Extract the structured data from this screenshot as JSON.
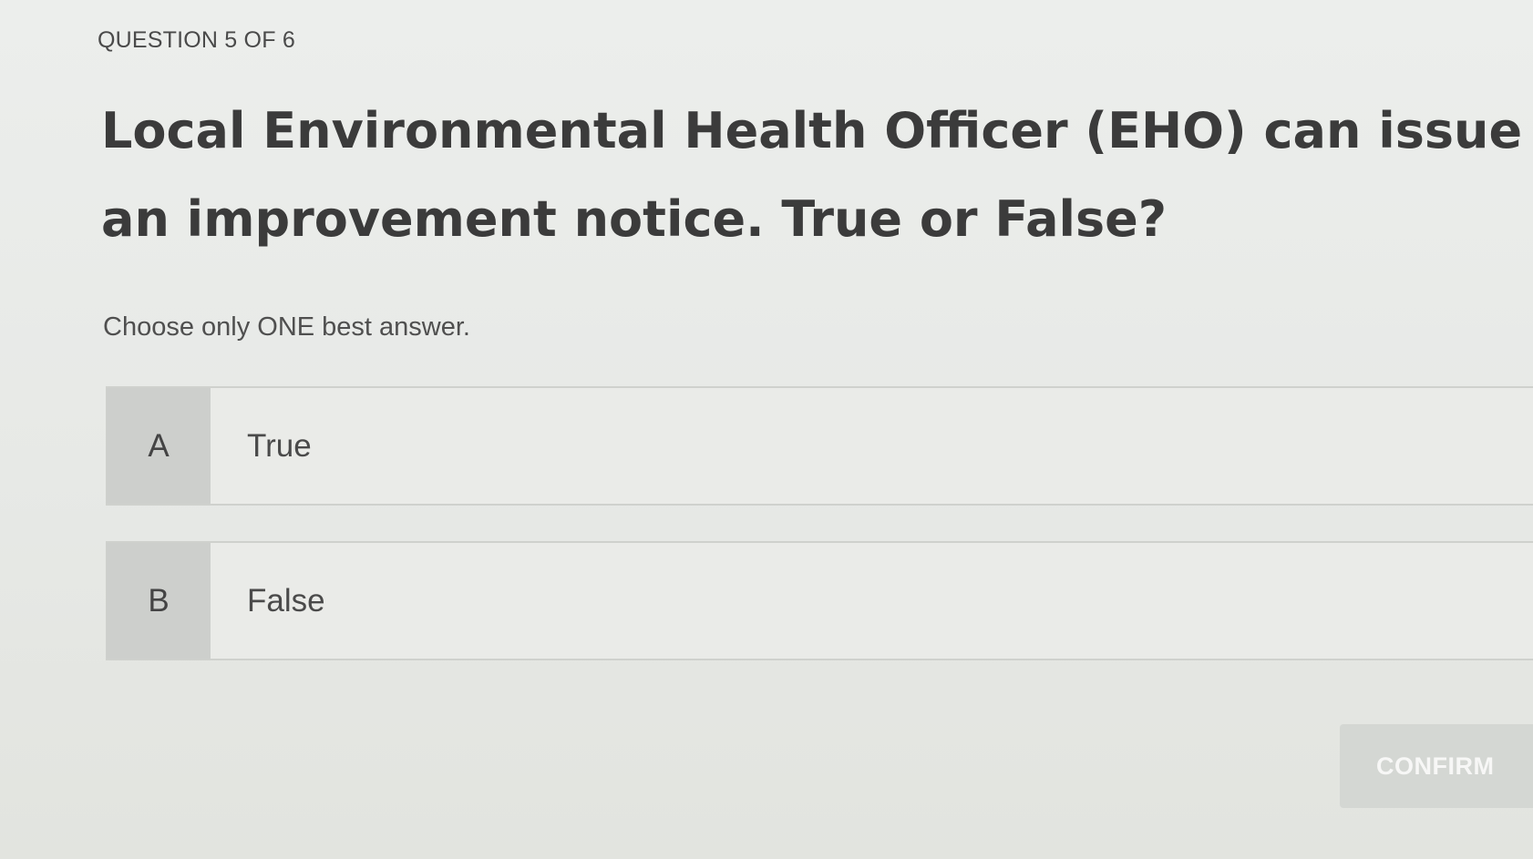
{
  "header": {
    "question_counter": "QUESTION 5 OF 6"
  },
  "question": {
    "text": "Local Environmental Health Officer (EHO) can issue an improvement notice. True or False?",
    "instruction": "Choose only ONE best answer."
  },
  "options": [
    {
      "letter": "A",
      "label": "True"
    },
    {
      "letter": "B",
      "label": "False"
    }
  ],
  "actions": {
    "confirm_label": "CONFIRM"
  }
}
